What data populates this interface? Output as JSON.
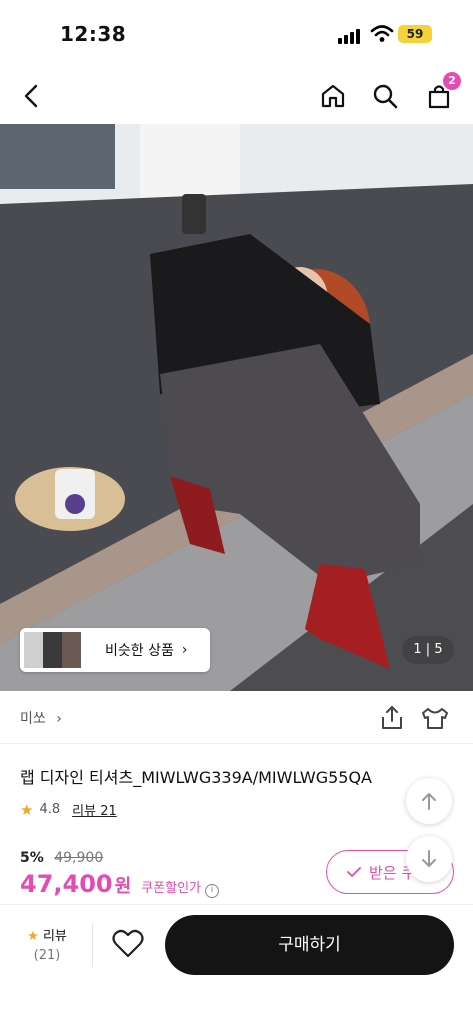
{
  "status": {
    "time": "12:38",
    "battery": "59"
  },
  "nav": {
    "cart_count": "2"
  },
  "hero": {
    "similar_label": "비슷한 상품",
    "similar_chevron": "›",
    "pager": "1 | 5"
  },
  "product": {
    "brand": "미쏘",
    "brand_chevron": "›",
    "title": "랩 디자인 티셔츠_MIWLWG339A/MIWLWG55QA",
    "rating": "4.8",
    "reviews_link": "리뷰 21",
    "discount": "5%",
    "original_price": "49,900",
    "price": "47,400",
    "currency": "원",
    "coupon_text": "쿠폰할인가",
    "coupon_button": "받은 쿠"
  },
  "bottom": {
    "review_label": "리뷰",
    "review_count": "(21)",
    "buy_label": "구매하기"
  },
  "icons": [
    "back-icon",
    "home-icon",
    "search-icon",
    "bag-icon",
    "share-icon",
    "hanger-icon",
    "heart-icon",
    "star-icon",
    "arrow-up-icon",
    "arrow-down-icon",
    "check-icon",
    "info-icon"
  ],
  "colors": {
    "accent": "#e64bb5",
    "buy_button": "#141414",
    "star": "#f5a623"
  }
}
